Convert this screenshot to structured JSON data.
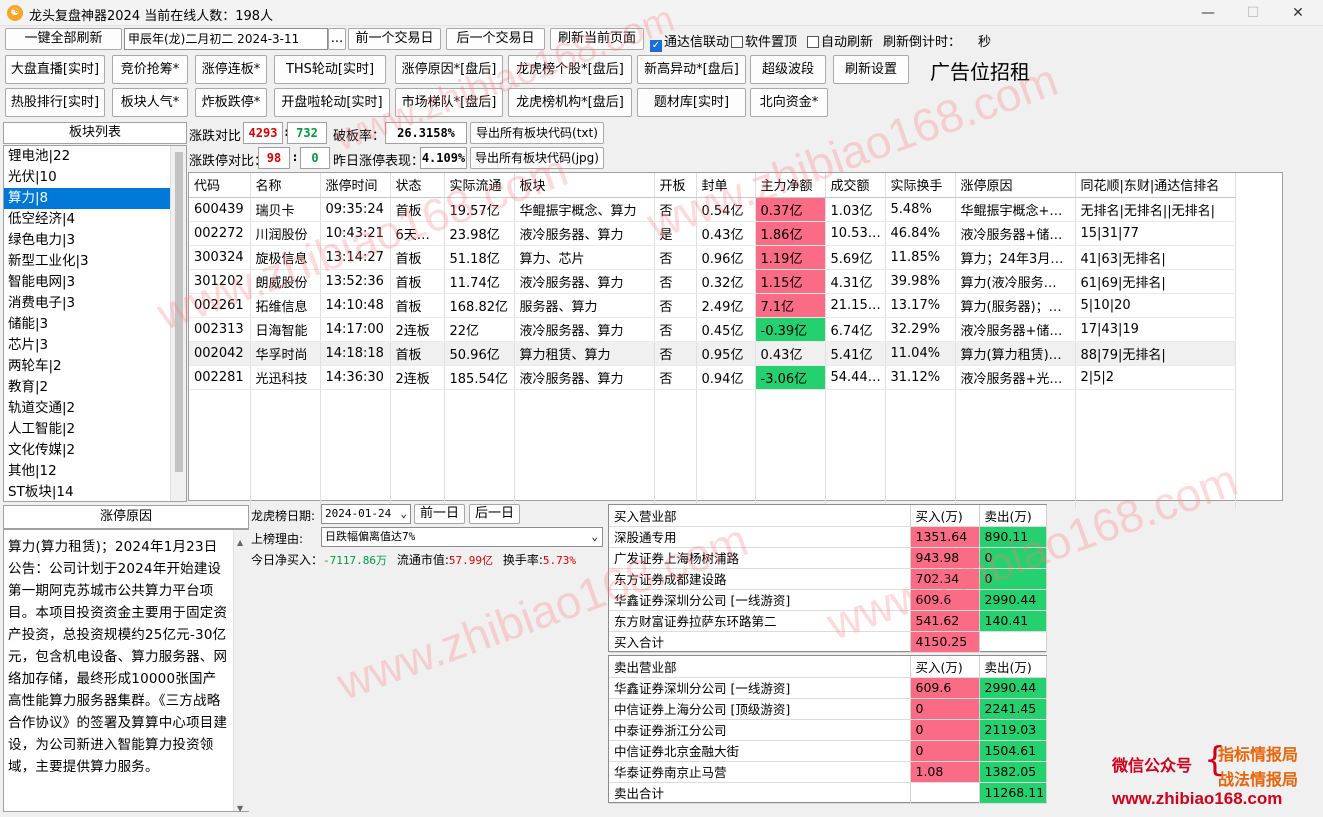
{
  "window": {
    "title": "龙头复盘神器2024 当前在线人数：198人",
    "icon": "app-logo-icon",
    "minimize": "—",
    "maximize": "☐",
    "close": "✕"
  },
  "toolbar": {
    "refresh_all": "一键全部刷新",
    "date_value": "甲辰年(龙)二月初二  2024-3-11",
    "date_picker": "...",
    "prev_day": "前一个交易日",
    "next_day": "后一个交易日",
    "refresh_page": "刷新当前页面",
    "tdx_link": "通达信联动",
    "tdx_link_checked": true,
    "pin_top": "软件置顶",
    "pin_top_checked": false,
    "auto_refresh": "自动刷新",
    "auto_refresh_checked": false,
    "countdown_label": "刷新倒计时：",
    "countdown_unit": "秒"
  },
  "nav_row1": [
    "大盘直播[实时]",
    "竞价抢筹*",
    "涨停连板*",
    "THS轮动[实时]",
    "涨停原因*[盘后]",
    "龙虎榜个股*[盘后]",
    "新高异动*[盘后]",
    "超级波段",
    "刷新设置"
  ],
  "ad_text": "广告位招租",
  "nav_row2": [
    "热股排行[实时]",
    "板块人气*",
    "炸板跌停*",
    "开盘啦轮动[实时]",
    "市场梯队*[盘后]",
    "龙虎榜机构*[盘后]",
    "题材库[实时]",
    "北向资金*"
  ],
  "sector_panel": {
    "header": "板块列表",
    "items": [
      "锂电池|22",
      "光伏|10",
      "算力|8",
      "低空经济|4",
      "绿色电力|3",
      "新型工业化|3",
      "智能电网|3",
      "消费电子|3",
      "储能|3",
      "芯片|3",
      "两轮车|2",
      "教育|2",
      "轨道交通|2",
      "人工智能|2",
      "文化传媒|2",
      "其他|12",
      "ST板块|14"
    ],
    "selected_index": 2
  },
  "stats": {
    "rise_fall_label": "涨跌对比：",
    "rise": "4293",
    "sep": ":",
    "fall": "732",
    "break_rate_label": "破板率：",
    "break_rate": "26.3158%",
    "export_txt": "导出所有板块代码(txt)",
    "limit_label": "涨跌停对比：",
    "limit_up": "98",
    "limit_down": "0",
    "yesterday_label": "昨日涨停表现：",
    "yesterday_value": "4.109%",
    "export_jpg": "导出所有板块代码(jpg)"
  },
  "stock_table": {
    "columns": [
      "代码",
      "名称",
      "涨停时间",
      "状态",
      "实际流通",
      "板块",
      "开板",
      "封单",
      "主力净额",
      "成交额",
      "实际换手",
      "涨停原因",
      "同花顺|东财|通达信排名"
    ],
    "rows": [
      {
        "code": "600439",
        "name": "瑞贝卡",
        "time": "09:35:24",
        "status": "首板",
        "float": "19.57亿",
        "sector": "华鲲振宇概念、算力",
        "open": "否",
        "seal": "0.54亿",
        "net": "0.37亿",
        "net_color": "pink",
        "turnover": "1.03亿",
        "rate": "5.48%",
        "reason": "华鲲振宇概念+…",
        "rank": "无排名|无排名||无排名|"
      },
      {
        "code": "002272",
        "name": "川润股份",
        "time": "10:43:21",
        "status": "6天…",
        "float": "23.98亿",
        "sector": "液冷服务器、算力",
        "open": "是",
        "seal": "0.43亿",
        "net": "1.86亿",
        "net_color": "pink",
        "turnover": "10.53…",
        "rate": "46.84%",
        "reason": "液冷服务器+储…",
        "rank": "15|31|77"
      },
      {
        "code": "300324",
        "name": "旋极信息",
        "time": "13:14:27",
        "status": "首板",
        "float": "51.18亿",
        "sector": "算力、芯片",
        "open": "否",
        "seal": "0.96亿",
        "net": "1.19亿",
        "net_color": "pink",
        "turnover": "5.69亿",
        "rate": "11.85%",
        "reason": "算力；24年3月…",
        "rank": "41|63|无排名|"
      },
      {
        "code": "301202",
        "name": "朗威股份",
        "time": "13:52:36",
        "status": "首板",
        "float": "11.74亿",
        "sector": "液冷服务器、算力",
        "open": "否",
        "seal": "0.32亿",
        "net": "1.15亿",
        "net_color": "pink",
        "turnover": "4.31亿",
        "rate": "39.98%",
        "reason": "算力(液冷服务…",
        "rank": "61|69|无排名|"
      },
      {
        "code": "002261",
        "name": "拓维信息",
        "time": "14:10:48",
        "status": "首板",
        "float": "168.82亿",
        "sector": "服务器、算力",
        "open": "否",
        "seal": "2.49亿",
        "net": "7.1亿",
        "net_color": "pink",
        "turnover": "21.15…",
        "rate": "13.17%",
        "reason": "算力(服务器)；…",
        "rank": "5|10|20"
      },
      {
        "code": "002313",
        "name": "日海智能",
        "time": "14:17:00",
        "status": "2连板",
        "float": "22亿",
        "sector": "液冷服务器、算力",
        "open": "否",
        "seal": "0.45亿",
        "net": "-0.39亿",
        "net_color": "green",
        "turnover": "6.74亿",
        "rate": "32.29%",
        "reason": "液冷服务器+储…",
        "rank": "17|43|19"
      },
      {
        "code": "002042",
        "name": "华孚时尚",
        "time": "14:18:18",
        "status": "首板",
        "float": "50.96亿",
        "sector": "算力租赁、算力",
        "open": "否",
        "seal": "0.95亿",
        "net": "0.43亿",
        "net_color": "none",
        "turnover": "5.41亿",
        "rate": "11.04%",
        "reason": "算力(算力租赁)…",
        "rank": "88|79|无排名|"
      },
      {
        "code": "002281",
        "name": "光迅科技",
        "time": "14:36:30",
        "status": "2连板",
        "float": "185.54亿",
        "sector": "液冷服务器、算力",
        "open": "否",
        "seal": "0.94亿",
        "net": "-3.06亿",
        "net_color": "green",
        "turnover": "54.44…",
        "rate": "31.12%",
        "reason": "液冷服务器+光…",
        "rank": "2|5|2"
      }
    ],
    "highlighted_row": 6
  },
  "reason_panel": {
    "header": "涨停原因",
    "text": "算力(算力租赁)；2024年1月23日公告：公司计划于2024年开始建设第一期阿克苏城市公共算力平台项目。本项目投资资金主要用于固定资产投资，总投资规模约25亿元-30亿元，包含机电设备、算力服务器、网络加存储，最终形成10000张国产高性能算力服务器集群。《三方战略合作协议》的签署及算算中心项目建设，为公司新进入智能算力投资领域，主要提供算力服务。"
  },
  "dragon_tiger": {
    "date_label": "龙虎榜日期:",
    "date": "2024-01-24",
    "prev": "前一日",
    "next": "后一日",
    "reason_label": "上榜理由:",
    "reason": "日跌幅偏离值达7%",
    "net_buy_label": "今日净买入：",
    "net_buy": "-7117.86万",
    "float_mv_label": "流通市值:",
    "float_mv": "57.99亿",
    "turnover_label": "换手率:",
    "turnover": "5.73%"
  },
  "buy_table": {
    "columns": [
      "买入营业部",
      "买入(万)",
      "卖出(万)"
    ],
    "rows": [
      [
        "深股通专用",
        "1351.64",
        "890.11"
      ],
      [
        "广发证券上海杨树浦路",
        "943.98",
        "0"
      ],
      [
        "东方证券成都建设路",
        "702.34",
        "0"
      ],
      [
        "华鑫证券深圳分公司 [一线游资]",
        "609.6",
        "2990.44"
      ],
      [
        "东方财富证券拉萨东环路第二",
        "541.62",
        "140.41"
      ]
    ],
    "total_label": "买入合计",
    "total": "4150.25"
  },
  "sell_table": {
    "columns": [
      "卖出营业部",
      "买入(万)",
      "卖出(万)"
    ],
    "rows": [
      [
        "华鑫证券深圳分公司 [一线游资]",
        "609.6",
        "2990.44"
      ],
      [
        "中信证券上海分公司 [顶级游资]",
        "0",
        "2241.45"
      ],
      [
        "中泰证券浙江分公司",
        "0",
        "2119.03"
      ],
      [
        "中信证券北京金融大街",
        "0",
        "1504.61"
      ],
      [
        "华泰证券南京止马营",
        "1.08",
        "1382.05"
      ]
    ],
    "total_label": "卖出合计",
    "total": "11268.11"
  },
  "brand": {
    "wechat": "微信公众号",
    "line1": "指标情报局",
    "line2": "战法情报局",
    "url": "www.zhibiao168.com"
  },
  "watermark": "www.zhibiao168.com",
  "colors": {
    "pink": "#fa6b86",
    "green": "#24d16e",
    "selected": "#0078d7",
    "brand_red": "#d0021b"
  }
}
